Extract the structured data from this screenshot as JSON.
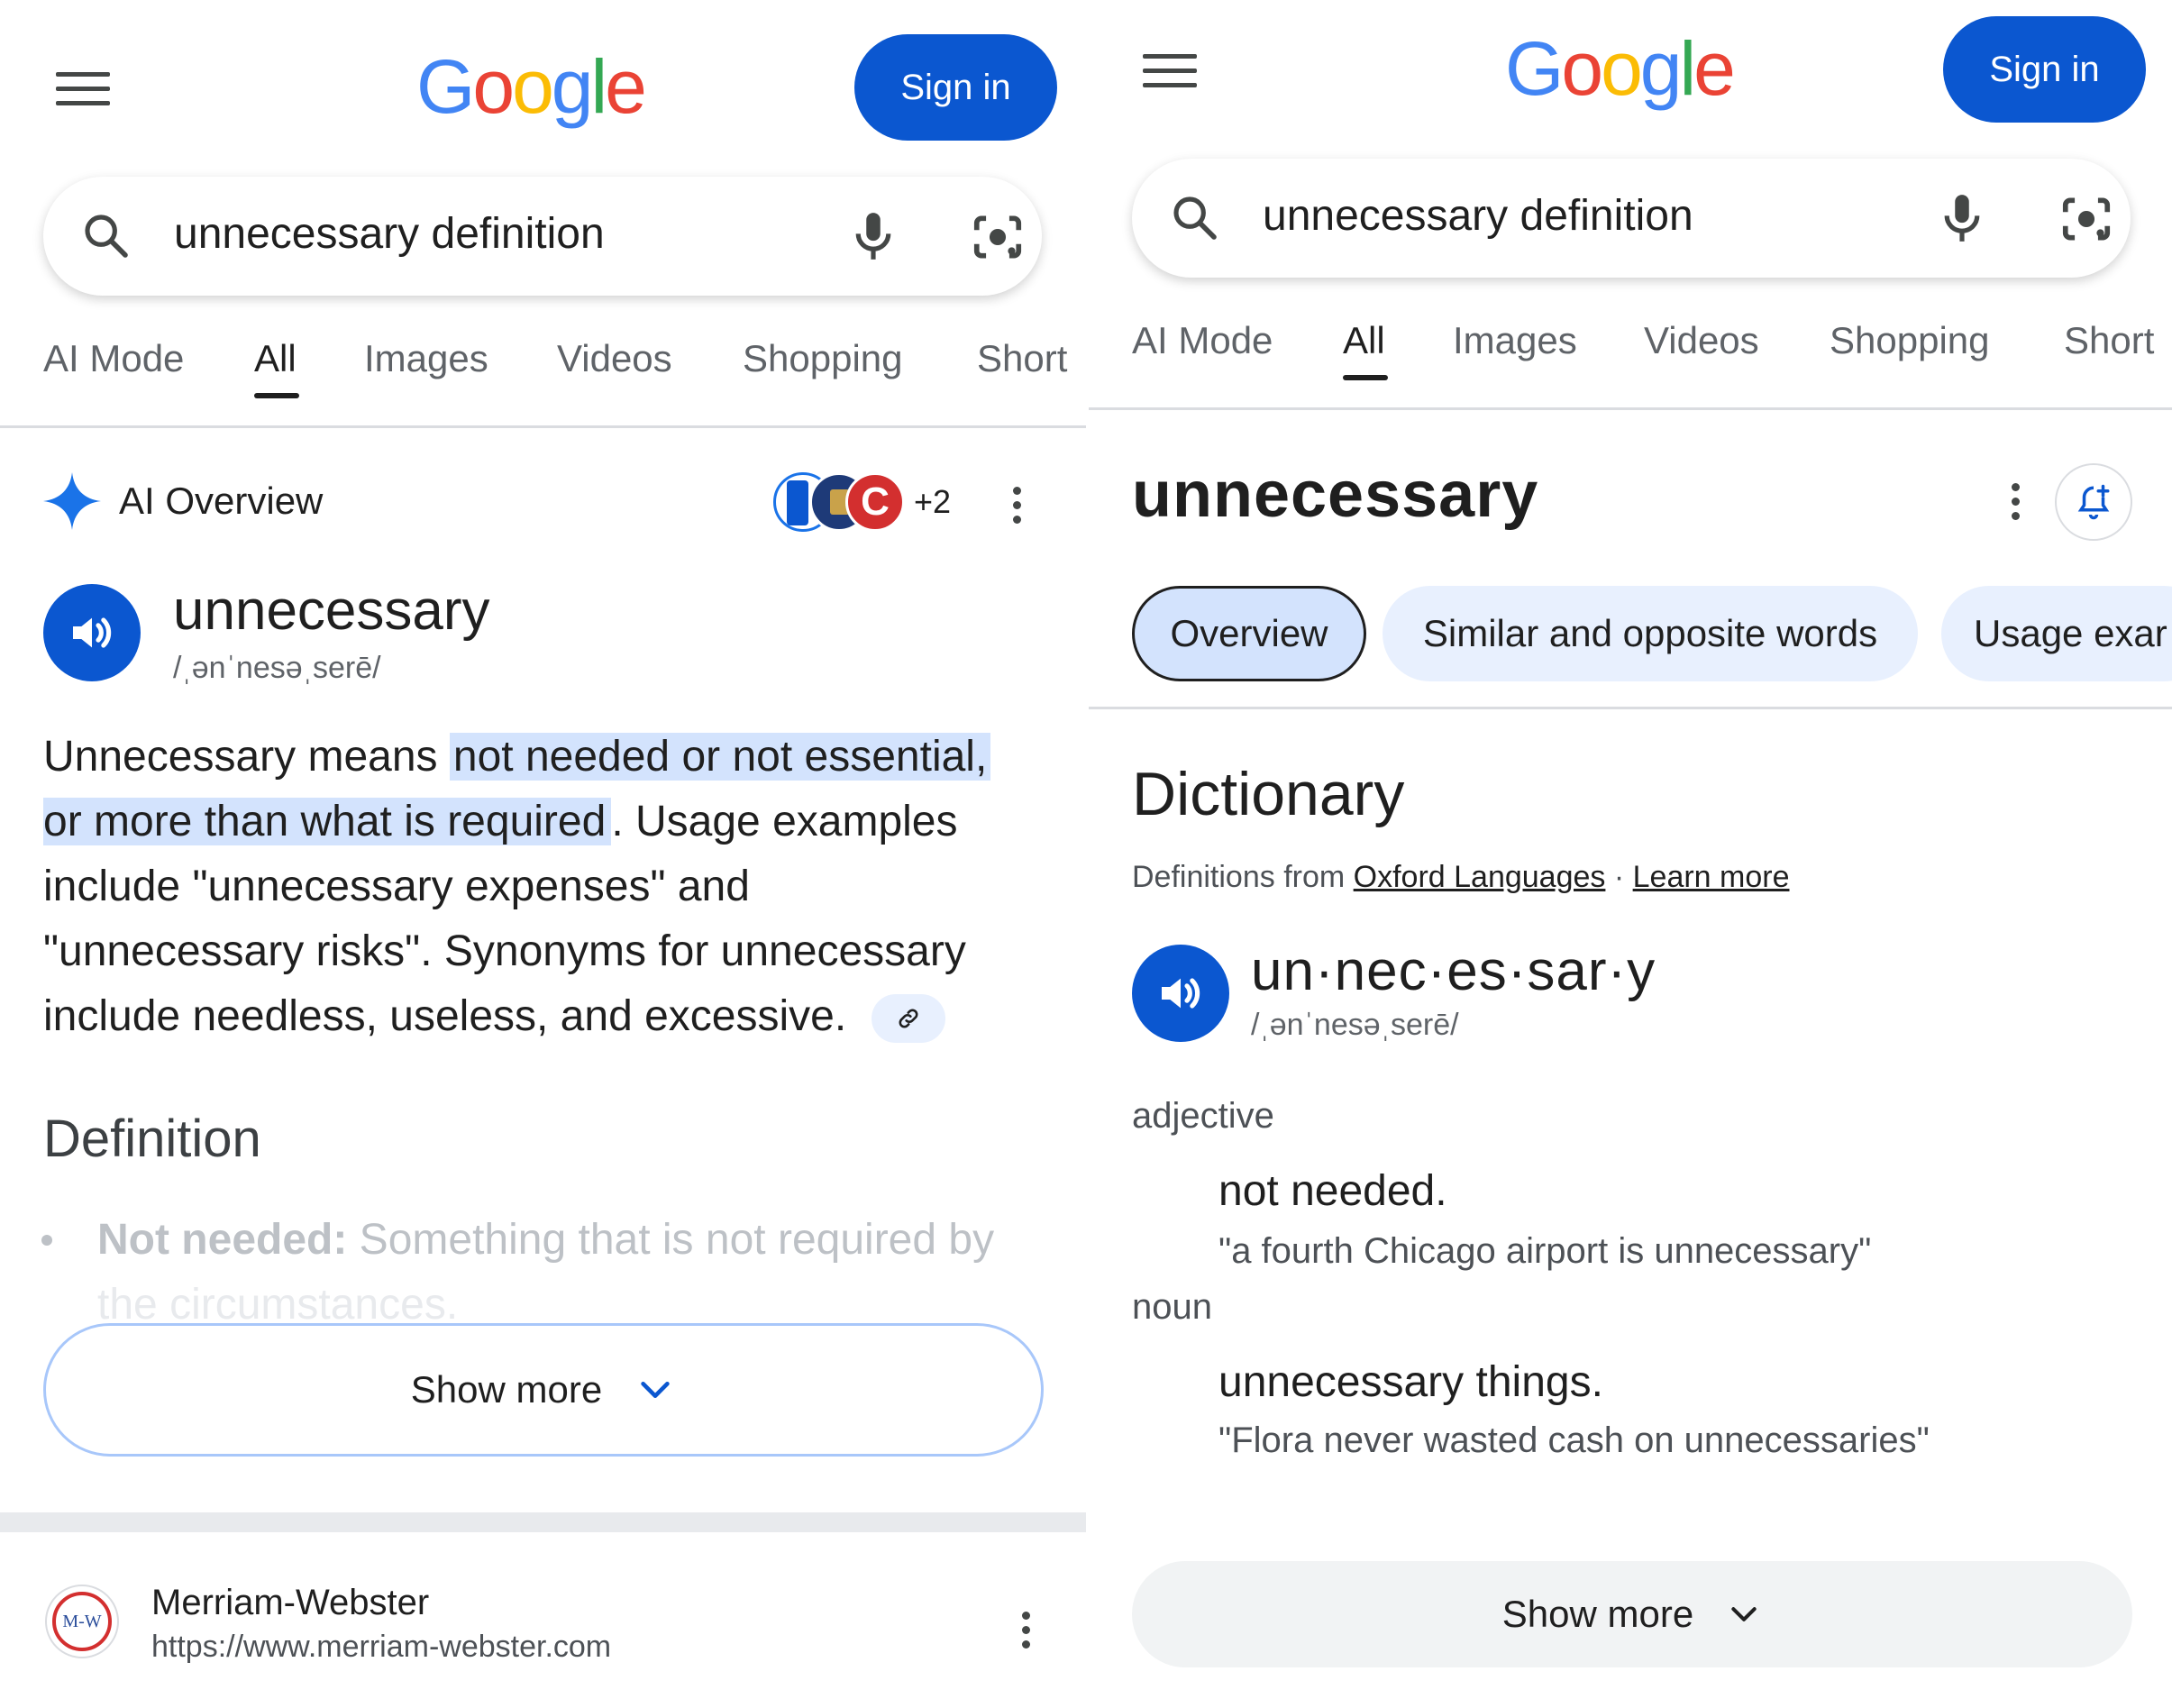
{
  "left": {
    "header": {
      "logo": "Google",
      "sign_in": "Sign in"
    },
    "search": {
      "query": "unnecessary definition"
    },
    "tabs": [
      "AI Mode",
      "All",
      "Images",
      "Videos",
      "Shopping",
      "Short"
    ],
    "ai_overview": {
      "title": "AI Overview",
      "sources_more": "+2",
      "word": "unnecessary",
      "phonetic": "/ˌənˈnesəˌserē/",
      "text_before": "Unnecessary means ",
      "text_highlight_1": "not needed or not essential,",
      "text_highlight_2": "or more than what is required",
      "text_after_1": ". Usage examples",
      "line3": "include \"unnecessary expenses\" and",
      "line4": "\"unnecessary risks\". Synonyms for unnecessary",
      "line5": "include needless, useless, and excessive.",
      "definition_heading": "Definition",
      "definition_term": "Not needed:",
      "definition_text": " Something that is not required by",
      "definition_text_2": "the circumstances.",
      "show_more": "Show more"
    },
    "result": {
      "favicon_text": "M-W",
      "site_name": "Merriam-Webster",
      "url": "https://www.merriam-webster.com"
    }
  },
  "right": {
    "header": {
      "logo": "Google",
      "sign_in": "Sign in"
    },
    "search": {
      "query": "unnecessary definition"
    },
    "tabs": [
      "AI Mode",
      "All",
      "Images",
      "Videos",
      "Shopping",
      "Short"
    ],
    "entity_title": "unnecessary",
    "chips": [
      "Overview",
      "Similar and opposite words",
      "Usage exar"
    ],
    "dictionary": {
      "heading": "Dictionary",
      "source_prefix": "Definitions from ",
      "source_link": "Oxford Languages",
      "separator": " · ",
      "learn_more": "Learn more",
      "word": "un·nec·es·sar·y",
      "phonetic": "/ˌənˈnesəˌserē/",
      "pos1": "adjective",
      "def1": "not needed.",
      "ex1": "\"a fourth Chicago airport is unnecessary\"",
      "pos2": "noun",
      "def2": "unnecessary things.",
      "ex2": "\"Flora never wasted cash on unnecessaries\"",
      "show_more": "Show more"
    }
  },
  "colors": {
    "google_blue": "#4285f4",
    "google_red": "#ea4335",
    "google_yellow": "#fbbc05",
    "google_green": "#34a853",
    "primary": "#0b57d0",
    "highlight": "#d3e3fd"
  }
}
